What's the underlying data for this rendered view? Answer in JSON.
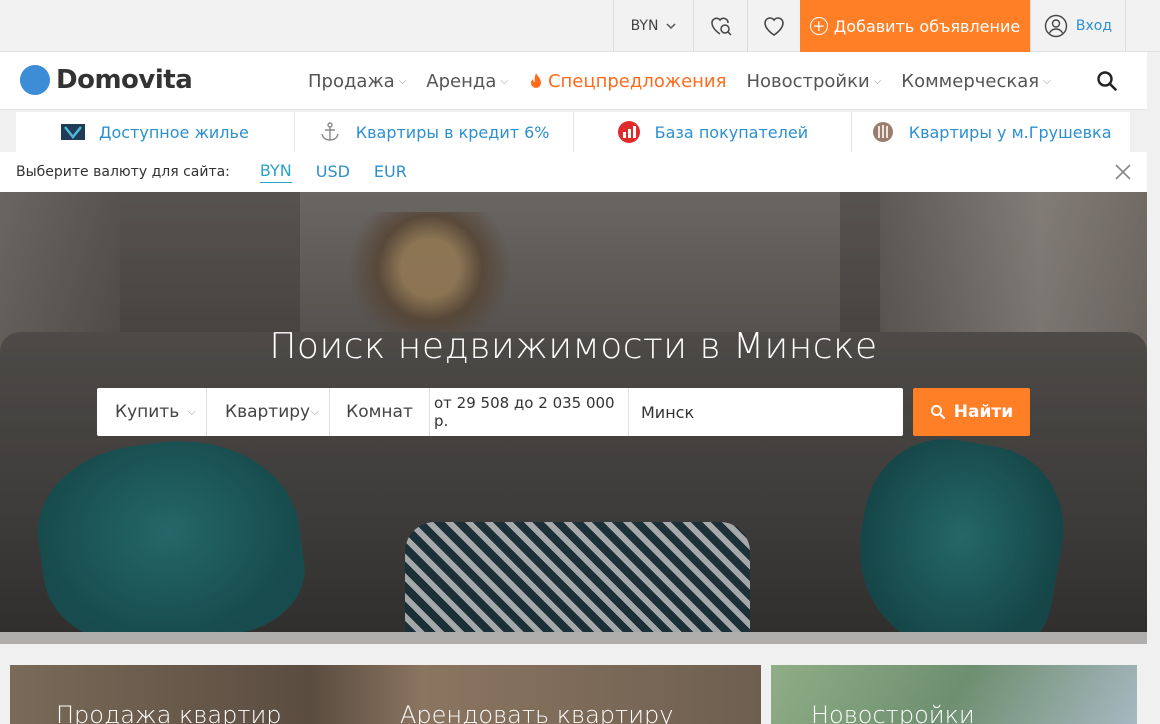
{
  "topbar": {
    "currency": "BYN",
    "add_listing": "Добавить объявление",
    "login": "Вход"
  },
  "brand": {
    "name": "Domovita",
    "logo_color": "#3c8dd6"
  },
  "nav": {
    "items": [
      {
        "label": "Продажа",
        "has_dropdown": true
      },
      {
        "label": "Аренда",
        "has_dropdown": true
      },
      {
        "label": "Спецпредложения",
        "has_dropdown": false
      },
      {
        "label": "Новостройки",
        "has_dropdown": true
      },
      {
        "label": "Коммерческая",
        "has_dropdown": true
      }
    ]
  },
  "promos": [
    {
      "label": "Доступное жилье",
      "icon": "tv-icon"
    },
    {
      "label": "Квартиры в кредит 6%",
      "icon": "anchor-icon"
    },
    {
      "label": "База покупателей",
      "icon": "chart-icon"
    },
    {
      "label": "Квартиры у м.Грушевка",
      "icon": "metro-icon"
    }
  ],
  "currency_bar": {
    "label": "Выберите валюту для сайта:",
    "options": [
      "BYN",
      "USD",
      "EUR"
    ],
    "selected": "BYN"
  },
  "hero": {
    "title": "Поиск недвижимости в Минске"
  },
  "search": {
    "deal": "Купить",
    "type": "Квартиру",
    "rooms": "Комнат",
    "price": "от 29 508 до 2 035 000 р.",
    "city": "Минск",
    "submit": "Найти"
  },
  "tiles": [
    {
      "label": "Продажа квартир"
    },
    {
      "label": "Арендовать квартиру"
    },
    {
      "label": "Новостройки"
    }
  ],
  "colors": {
    "accent": "#ff7f27",
    "link": "#2d8fd0",
    "special": "#ff6b1a"
  }
}
